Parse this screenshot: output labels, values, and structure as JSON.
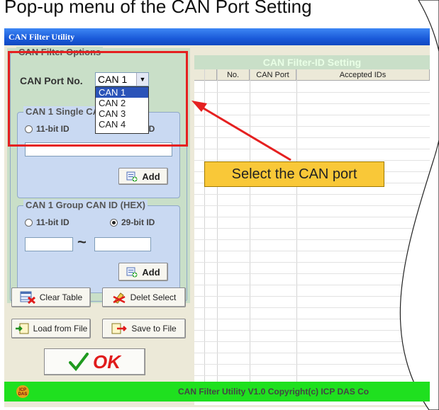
{
  "top_text": "Pop-up menu of the CAN Port Setting",
  "window": {
    "title": "CAN Filter Utility"
  },
  "options": {
    "group_title": "CAN Filter Options",
    "port_label": "CAN Port No.",
    "port_selected": "CAN 1",
    "port_options": [
      "CAN 1",
      "CAN 2",
      "CAN 3",
      "CAN 4"
    ]
  },
  "single": {
    "group_title": "CAN 1 Single CAN ID (HEX)",
    "radio_11": "11-bit ID",
    "radio_29": "29-bit ID",
    "input_value": "",
    "add_label": "Add"
  },
  "group": {
    "group_title": "CAN 1 Group CAN ID (HEX)",
    "radio_11": "11-bit ID",
    "radio_29": "29-bit ID",
    "from_value": "",
    "to_value": "",
    "separator": "~",
    "add_label": "Add"
  },
  "buttons": {
    "clear_table": "Clear Table",
    "delet_select": "Delet Select",
    "load_from_file": "Load from File",
    "save_to_file": "Save to File",
    "ok": "OK"
  },
  "table": {
    "header_title": "CAN Filter-ID Setting",
    "columns": [
      "No.",
      "CAN Port",
      "Accepted IDs"
    ]
  },
  "callout": "Select the CAN port",
  "status": {
    "text": "CAN Filter Utility  V1.0   Copyright(c) ICP DAS Co"
  },
  "colors": {
    "highlight_border": "#e52020",
    "callout_bg": "#f9c838",
    "status_bg": "#1fe01f",
    "titlebar": "#1a5ad9",
    "panel_green": "#c9dfc8",
    "panel_blue": "#c9d9f2"
  }
}
